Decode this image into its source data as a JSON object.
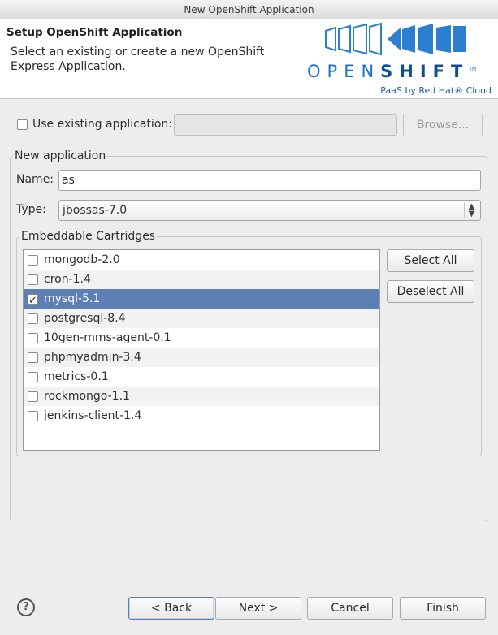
{
  "window": {
    "title": "New OpenShift Application"
  },
  "banner": {
    "title": "Setup OpenShift Application",
    "description": "Select an existing or create a new OpenShift Express Application.",
    "logo_text_light": "OPEN",
    "logo_text_bold": "SHIFT",
    "logo_tm": "TM",
    "logo_sub": "PaaS by Red Hat® Cloud"
  },
  "existing": {
    "checkbox_label": "Use existing application:",
    "checked": false,
    "value": "",
    "browse_label": "Browse..."
  },
  "new_app": {
    "group_label": "New application",
    "name_label": "Name:",
    "name_value": "as",
    "type_label": "Type:",
    "type_value": "jbossas-7.0"
  },
  "cartridges": {
    "group_label": "Embeddable Cartridges",
    "select_all": "Select All",
    "deselect_all": "Deselect All",
    "items": [
      {
        "label": "mongodb-2.0",
        "checked": false
      },
      {
        "label": "cron-1.4",
        "checked": false
      },
      {
        "label": "mysql-5.1",
        "checked": true
      },
      {
        "label": "postgresql-8.4",
        "checked": false
      },
      {
        "label": "10gen-mms-agent-0.1",
        "checked": false
      },
      {
        "label": "phpmyadmin-3.4",
        "checked": false
      },
      {
        "label": "metrics-0.1",
        "checked": false
      },
      {
        "label": "rockmongo-1.1",
        "checked": false
      },
      {
        "label": "jenkins-client-1.4",
        "checked": false
      }
    ]
  },
  "footer": {
    "help": "?",
    "back": "< Back",
    "next": "Next >",
    "cancel": "Cancel",
    "finish": "Finish"
  },
  "colors": {
    "selection": "#5d7fb3",
    "logo_blue": "#1a73c4"
  }
}
